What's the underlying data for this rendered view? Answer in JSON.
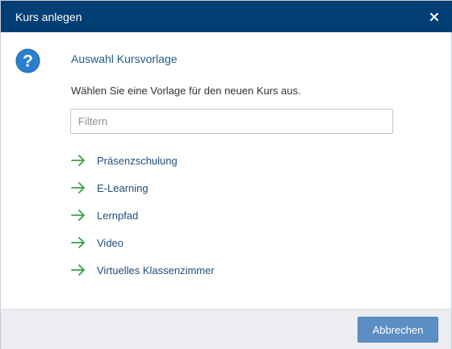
{
  "dialog": {
    "title": "Kurs anlegen",
    "close_icon": "close-icon"
  },
  "content": {
    "icon": "question-mark-icon",
    "heading": "Auswahl Kursvorlage",
    "instruction": "Wählen Sie eine Vorlage für den neuen Kurs aus.",
    "filter": {
      "placeholder": "Filtern",
      "value": ""
    },
    "options": [
      {
        "label": "Präsenzschulung",
        "icon": "arrow-right-icon"
      },
      {
        "label": "E-Learning",
        "icon": "arrow-right-icon"
      },
      {
        "label": "Lernpfad",
        "icon": "arrow-right-icon"
      },
      {
        "label": "Video",
        "icon": "arrow-right-icon"
      },
      {
        "label": "Virtuelles Klassenzimmer",
        "icon": "arrow-right-icon"
      }
    ]
  },
  "footer": {
    "cancel_label": "Abbrechen"
  },
  "colors": {
    "titlebar": "#003e73",
    "accent": "#1f5a8e",
    "arrow": "#3aa04a",
    "button": "#5b8fc4",
    "footer": "#ebedf0"
  }
}
